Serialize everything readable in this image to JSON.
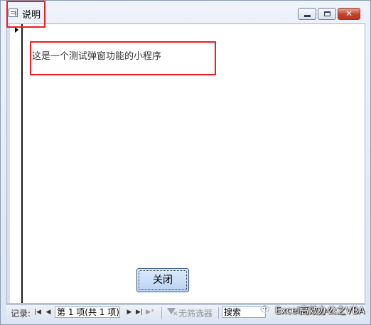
{
  "window": {
    "title": "说明"
  },
  "form": {
    "message": "这是一个测试弹窗功能的小程序",
    "close_button": "关闭"
  },
  "navbar": {
    "record_label": "记录:",
    "record_position": "第 1 项(共 1 项)",
    "filter_label": "无筛选器",
    "search_label": "搜索"
  },
  "watermark": {
    "text": "Excel高效办公之VBA"
  },
  "colors": {
    "highlight": "#ec1c24",
    "button_border": "#3b5f95"
  }
}
